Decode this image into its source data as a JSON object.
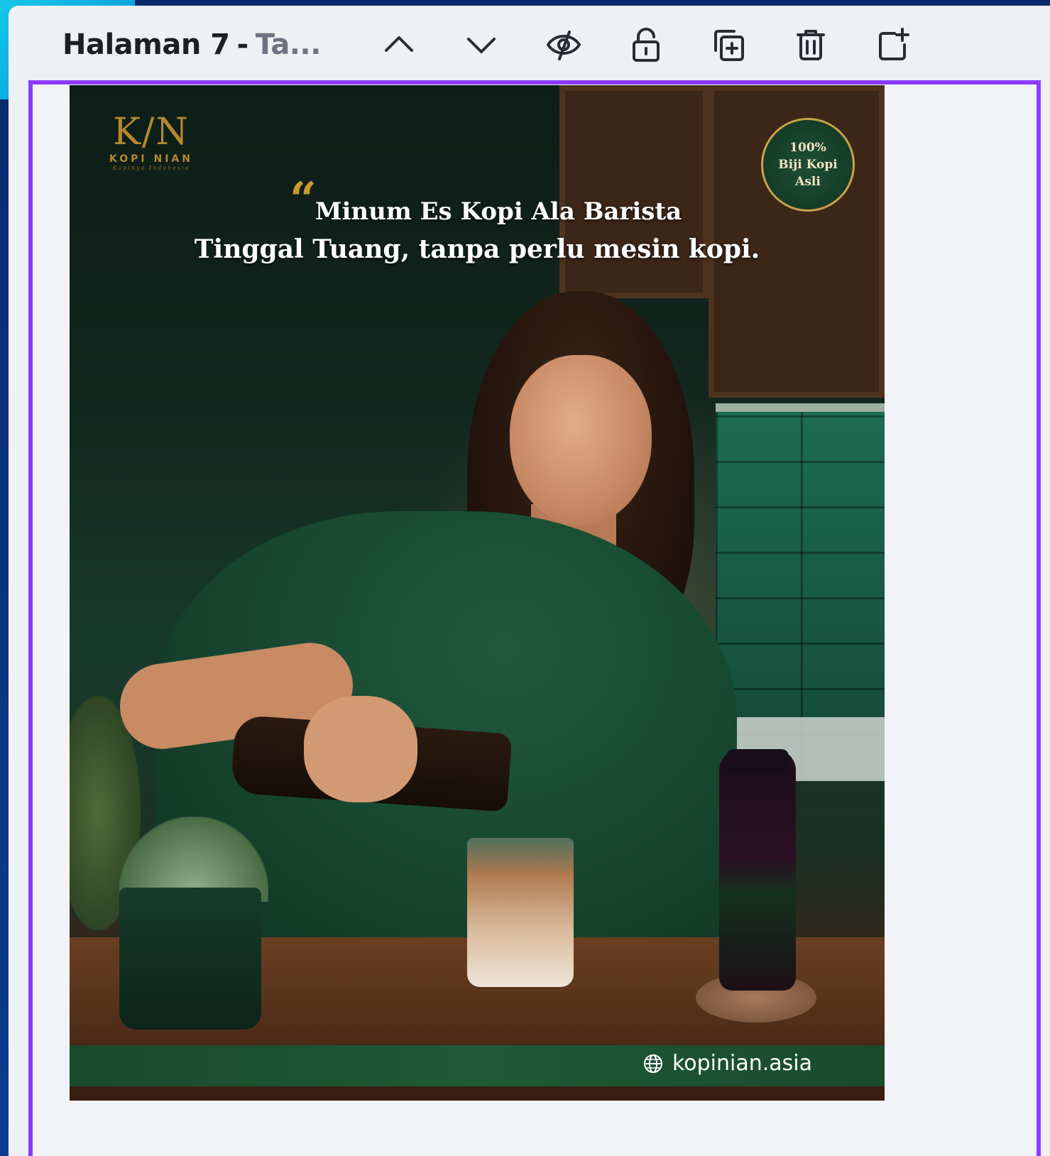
{
  "toolbar": {
    "page_title_main": "Halaman 7",
    "page_title_separator": "-",
    "page_title_rest": "Ta...",
    "buttons": [
      {
        "name": "move-page-up",
        "icon": "chevron-up-icon"
      },
      {
        "name": "move-page-down",
        "icon": "chevron-down-icon"
      },
      {
        "name": "hide-page",
        "icon": "eye-off-icon"
      },
      {
        "name": "lock-page",
        "icon": "lock-icon"
      },
      {
        "name": "duplicate-page",
        "icon": "duplicate-icon"
      },
      {
        "name": "delete-page",
        "icon": "trash-icon"
      },
      {
        "name": "add-page",
        "icon": "add-page-icon"
      }
    ]
  },
  "poster": {
    "logo": {
      "mark": "K/N",
      "name": "KOPI NIAN",
      "tagline": "Kopinya Indonesia"
    },
    "badge": {
      "line1": "100%",
      "line2": "Biji Kopi",
      "line3": "Asli"
    },
    "quote_mark": "“",
    "headline_line1": "Minum Es Kopi Ala Barista",
    "headline_line2": "Tinggal Tuang, tanpa perlu mesin kopi.",
    "website": "kopinian.asia",
    "website_icon": "globe-icon"
  },
  "colors": {
    "selection_border": "#8b3dff",
    "gold": "#c99a2e",
    "background_blue": "#0b3d91",
    "accent_cyan": "#14c8e8",
    "panel": "#eef0f4"
  }
}
